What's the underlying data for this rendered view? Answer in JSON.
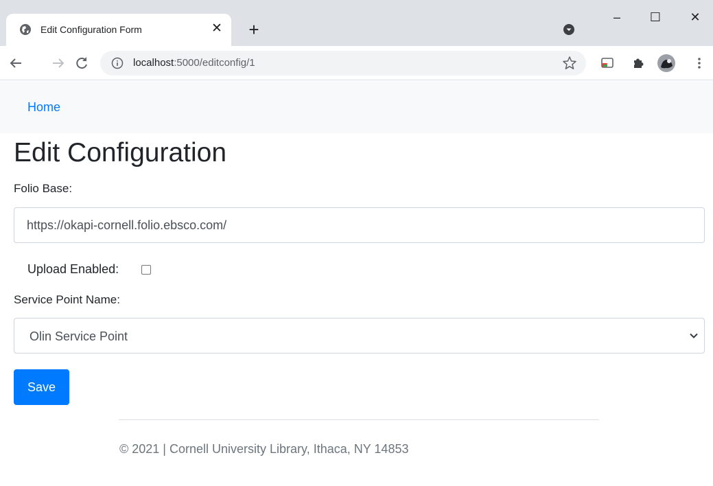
{
  "browser": {
    "tab_title": "Edit Configuration Form",
    "tab_close_glyph": "✕",
    "new_tab_glyph": "+",
    "url_host": "localhost",
    "url_path": ":5000/editconfig/1",
    "icons": {
      "tab_favicon": "globe-icon",
      "back": "back-arrow-icon",
      "forward": "forward-arrow-icon",
      "reload": "reload-icon",
      "info": "info-icon",
      "bookmark": "star-icon",
      "cast": "cast-icon",
      "extensions": "puzzle-icon",
      "avatar": "avatar",
      "menu": "kebab-menu-icon"
    },
    "window_controls": {
      "minimize": "–",
      "maximize": "☐",
      "close": "✕"
    }
  },
  "navbar": {
    "home_label": "Home"
  },
  "form": {
    "title": "Edit Configuration",
    "folio_base_label": "Folio Base:",
    "folio_base_value": "https://okapi-cornell.folio.ebsco.com/",
    "upload_enabled_label": "Upload Enabled:",
    "upload_enabled_checked": false,
    "service_point_label": "Service Point Name:",
    "service_point_selected": "Olin Service Point",
    "save_label": "Save"
  },
  "footer": {
    "text": "© 2021 | Cornell University Library, Ithaca, NY 14853"
  },
  "colors": {
    "link": "#007bff",
    "primary_button": "#007bff",
    "navbar_bg": "#f8f9fa",
    "tabstrip_bg": "#dee1e6",
    "footer_text": "#6c757d"
  }
}
